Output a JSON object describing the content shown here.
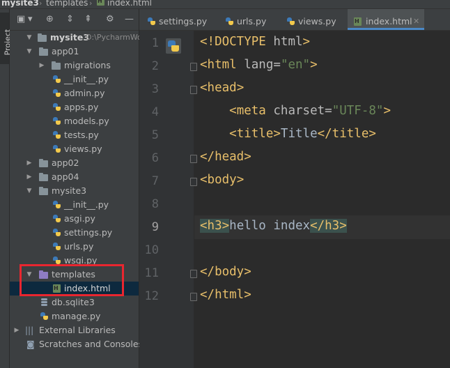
{
  "breadcrumb": {
    "project": "mysite3",
    "folder": "templates",
    "file": "index.html"
  },
  "sidebar": {
    "tab_label": "Project"
  },
  "tree": [
    {
      "label": "mysite3",
      "suffix": "D:\\PycharmWor",
      "icon": "folder-icon"
    },
    {
      "label": "app01",
      "icon": "folder-icon"
    },
    {
      "label": "migrations",
      "icon": "folder-icon"
    },
    {
      "label": "__init__.py",
      "icon": "python-file-icon"
    },
    {
      "label": "admin.py",
      "icon": "python-file-icon"
    },
    {
      "label": "apps.py",
      "icon": "python-file-icon"
    },
    {
      "label": "models.py",
      "icon": "python-file-icon"
    },
    {
      "label": "tests.py",
      "icon": "python-file-icon"
    },
    {
      "label": "views.py",
      "icon": "python-file-icon"
    },
    {
      "label": "app02",
      "icon": "folder-icon"
    },
    {
      "label": "app04",
      "icon": "folder-icon"
    },
    {
      "label": "mysite3",
      "icon": "folder-icon"
    },
    {
      "label": "__init__.py",
      "icon": "python-file-icon"
    },
    {
      "label": "asgi.py",
      "icon": "python-file-icon"
    },
    {
      "label": "settings.py",
      "icon": "python-file-icon"
    },
    {
      "label": "urls.py",
      "icon": "python-file-icon"
    },
    {
      "label": "wsgi.py",
      "icon": "python-file-icon"
    },
    {
      "label": "templates",
      "icon": "template-folder-icon"
    },
    {
      "label": "index.html",
      "icon": "html-file-icon"
    },
    {
      "label": "db.sqlite3",
      "icon": "database-icon"
    },
    {
      "label": "manage.py",
      "icon": "python-file-icon"
    },
    {
      "label": "External Libraries",
      "icon": "library-icon"
    },
    {
      "label": "Scratches and Consoles",
      "icon": "scratches-icon"
    }
  ],
  "tabs": [
    {
      "label": "settings.py",
      "active": false
    },
    {
      "label": "urls.py",
      "active": false
    },
    {
      "label": "views.py",
      "active": false
    },
    {
      "label": "index.html",
      "active": true
    }
  ],
  "editor": {
    "current_line": 9,
    "line_numbers": [
      "1",
      "2",
      "3",
      "4",
      "5",
      "6",
      "7",
      "8",
      "9",
      "10",
      "11",
      "12"
    ],
    "lines": [
      "<!DOCTYPE html>",
      "<html lang=\"en\">",
      "<head>",
      "    <meta charset=\"UTF-8\">",
      "    <title>Title</title>",
      "</head>",
      "<body>",
      "",
      "<h3>hello index</h3>",
      "",
      "</body>",
      "</html>"
    ]
  },
  "colors": {
    "highlight_box": "#e9262f",
    "selection": "#0d293e",
    "tag": "#e8bf6a",
    "string": "#6a8759",
    "active_tab_underline": "#4a88c7"
  }
}
